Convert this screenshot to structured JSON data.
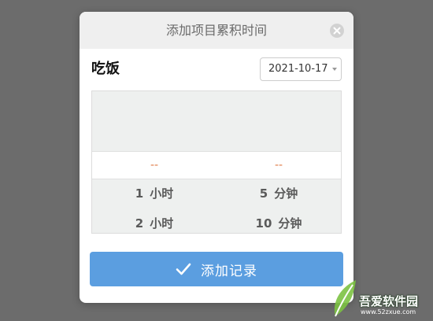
{
  "dialog": {
    "title": "添加项目累积时间",
    "close_icon": "close-circle-icon"
  },
  "item": {
    "name": "吃饭"
  },
  "date_select": {
    "value": "2021-10-17",
    "icon": "caret-down-icon"
  },
  "picker": {
    "columns": [
      {
        "selected": "--",
        "options": [
          {
            "num": "1",
            "unit": "小时"
          },
          {
            "num": "2",
            "unit": "小时"
          }
        ]
      },
      {
        "selected": "--",
        "options": [
          {
            "num": "5",
            "unit": "分钟"
          },
          {
            "num": "10",
            "unit": "分钟"
          }
        ]
      }
    ]
  },
  "submit_button": {
    "label": "添加记录",
    "icon": "checkmark-icon"
  },
  "watermark": {
    "name": "吾爱软件园",
    "url": "www.52zxue.com",
    "icon": "leaf-logo-icon"
  },
  "colors": {
    "page_background": "#6c6c6c",
    "header_background": "#efefef",
    "accent_button": "#5b9ee0",
    "placeholder_value": "#e07a45",
    "picker_background": "#eef0ef"
  }
}
